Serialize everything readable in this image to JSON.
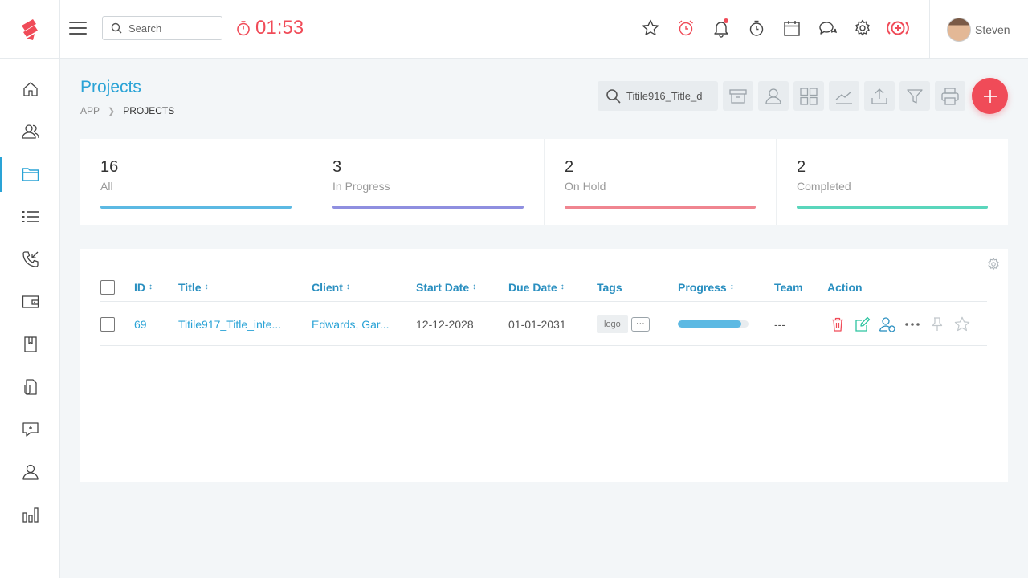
{
  "header": {
    "search_placeholder": "Search",
    "timer": "01:53",
    "user_name": "Steven"
  },
  "page": {
    "title": "Projects",
    "breadcrumb_app": "APP",
    "breadcrumb_current": "PROJECTS",
    "toolbar_search_value": "Titile916_Title_d"
  },
  "stats": [
    {
      "count": "16",
      "label": "All",
      "color": "#5cb9e3"
    },
    {
      "count": "3",
      "label": "In Progress",
      "color": "#8f8fe0"
    },
    {
      "count": "2",
      "label": "On Hold",
      "color": "#f08590"
    },
    {
      "count": "2",
      "label": "Completed",
      "color": "#5ad6bc"
    }
  ],
  "table": {
    "headers": {
      "id": "ID",
      "title": "Title",
      "client": "Client",
      "start_date": "Start Date",
      "due_date": "Due Date",
      "tags": "Tags",
      "progress": "Progress",
      "team": "Team",
      "action": "Action"
    },
    "sort_glyph": "↕",
    "rows": [
      {
        "id": "69",
        "title": "Titile917_Title_inte...",
        "client": "Edwards, Gar...",
        "start_date": "12-12-2028",
        "due_date": "01-01-2031",
        "tag": "logo",
        "more_tags": "···",
        "progress": 0.9,
        "team": "---"
      }
    ]
  },
  "colors": {
    "accent": "#2aa3d6",
    "danger": "#f04b58",
    "success": "#2cc4a0"
  }
}
